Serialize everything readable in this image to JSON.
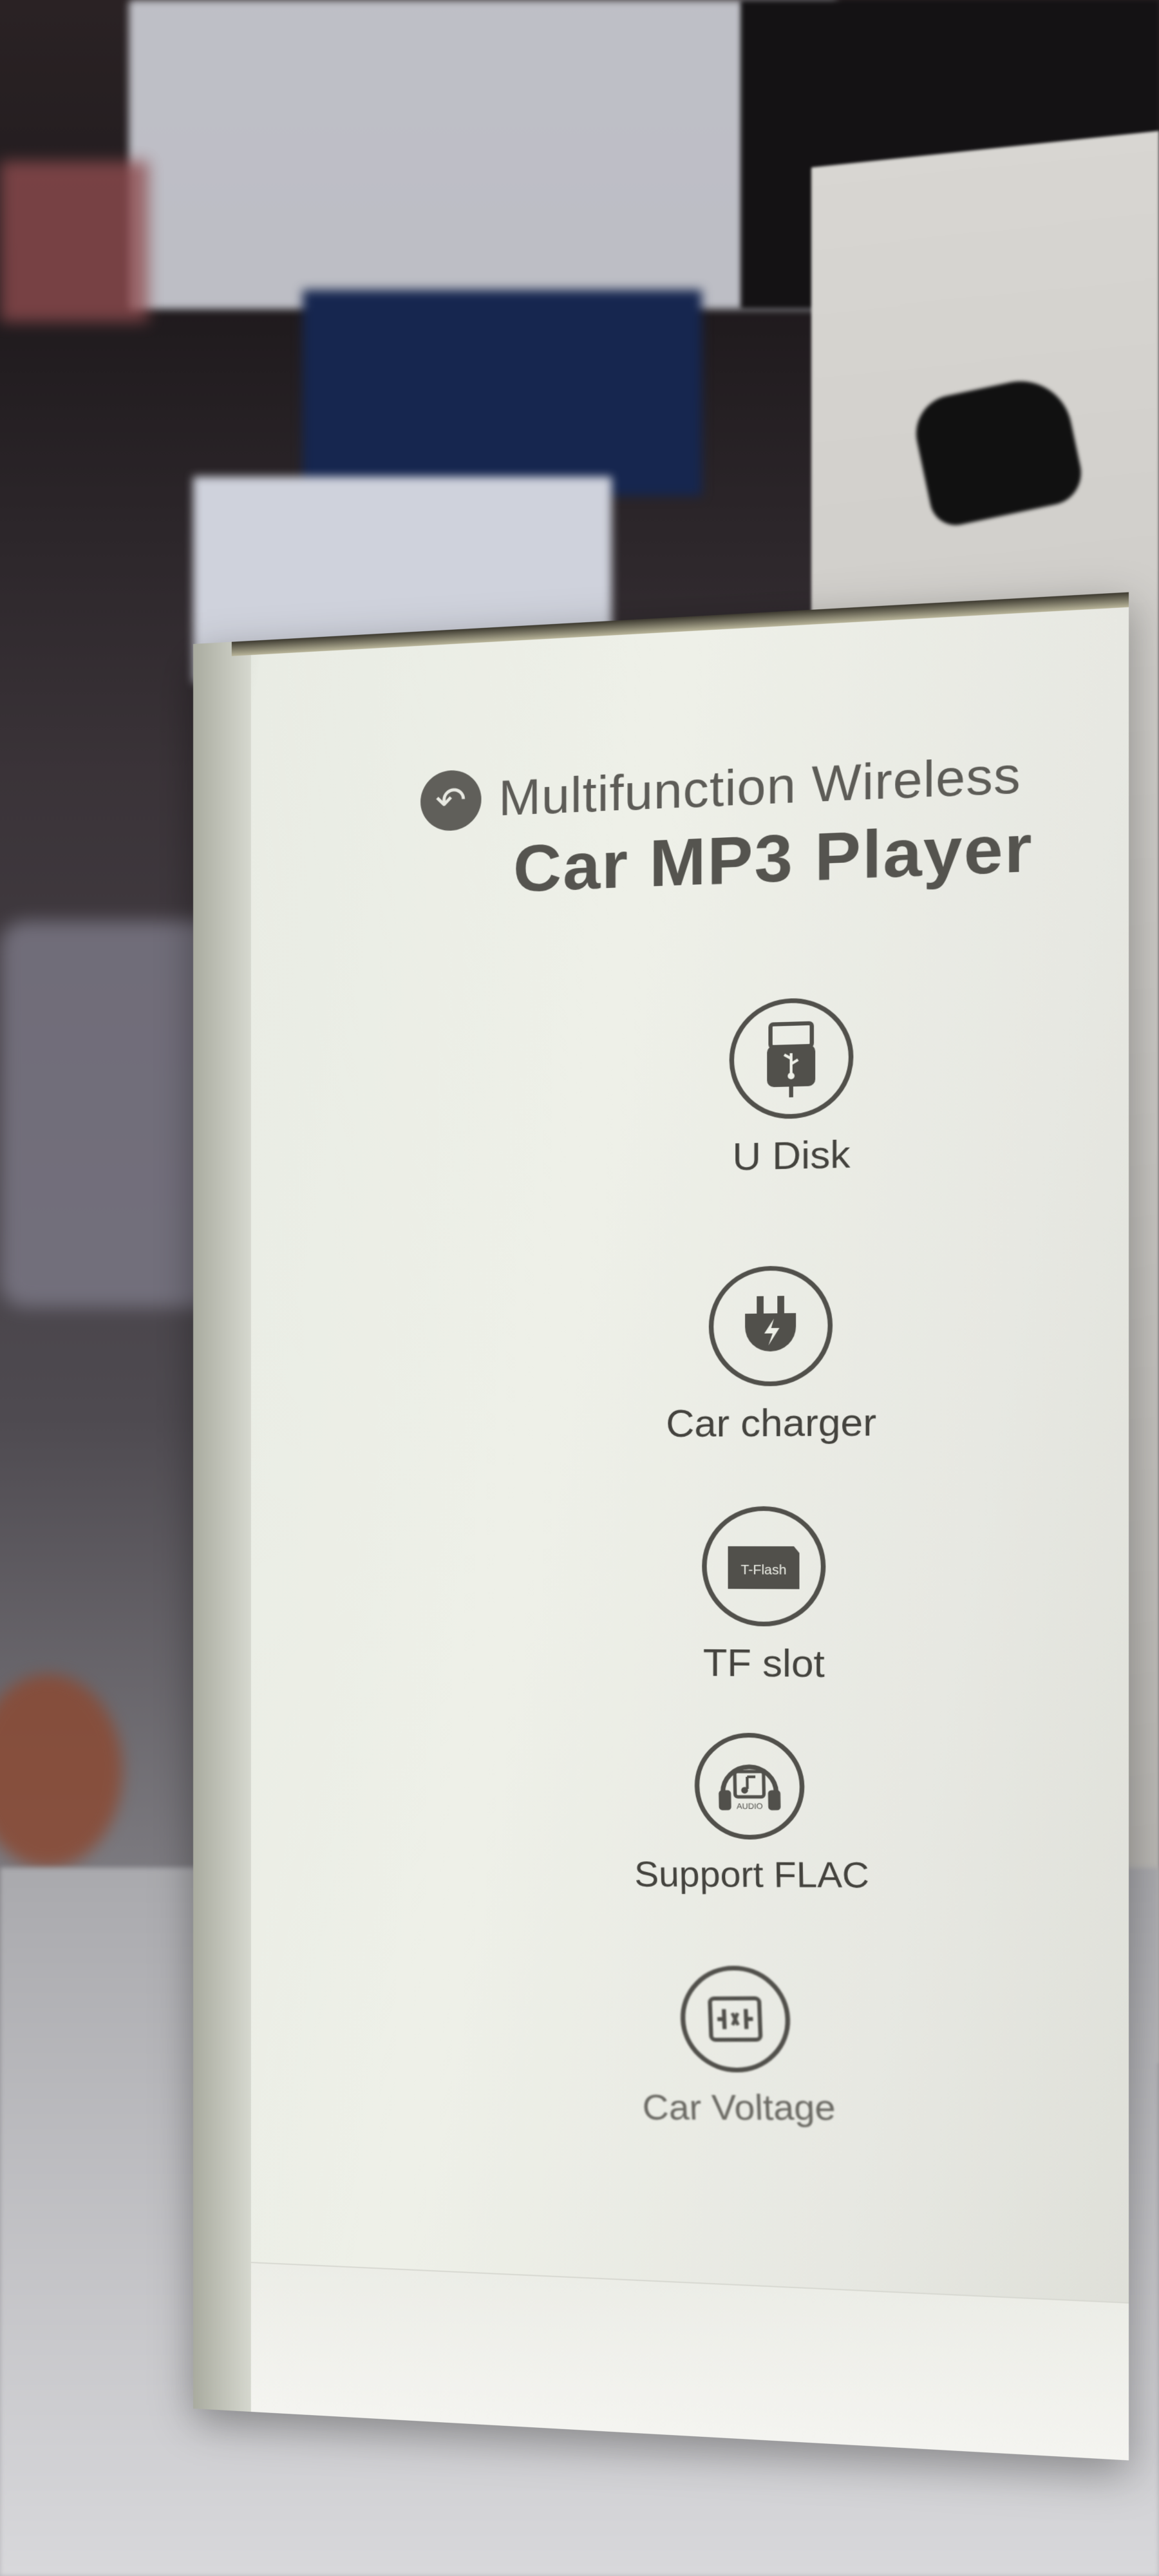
{
  "box": {
    "subtitle": "Multifunction Wireless",
    "title": "Car MP3 Player",
    "features": [
      {
        "label": "U Disk",
        "icon": "usb-icon"
      },
      {
        "label": "Car charger",
        "icon": "charger-plug-icon"
      },
      {
        "label": "TF slot",
        "icon": "tf-card-icon"
      },
      {
        "label": "Support FLAC",
        "icon": "music-note-icon"
      },
      {
        "label": "Car Voltage",
        "icon": "voltage-icon"
      }
    ],
    "icon_texts": {
      "tf_card": "T-Flash",
      "flac": "AUDIO"
    }
  },
  "colors": {
    "box_face": "#eef0e8",
    "print": "#55544f"
  }
}
